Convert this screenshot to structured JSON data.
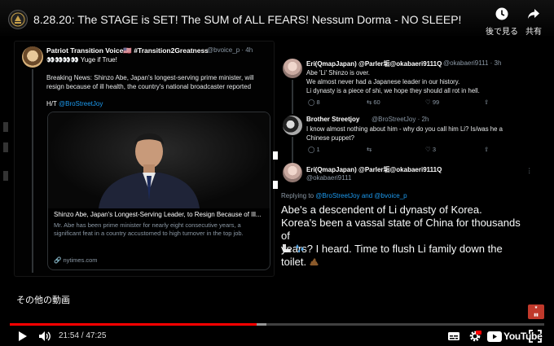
{
  "header": {
    "title": "8.28.20: The STAGE is SET! The SUM of ALL FEARS! Nessum Dorma - NO SLEEP!",
    "watch_later_label": "後で見る",
    "share_label": "共有"
  },
  "tweet1": {
    "name": "Patriot Transition Voice🇺🇸 #Transition2Greatness",
    "handle": "@bvoice_p · 4h",
    "line": "👀👀👀👀 Yuge if True!",
    "body": "Breaking News: Shinzo Abe, Japan's longest-serving prime minister, will resign because of ill health, the country's national broadcaster reported",
    "ht_prefix": "H/T",
    "ht_mention": "@BroStreetJoy",
    "card": {
      "title": "Shinzo Abe, Japan's Longest-Serving Leader, to Resign Because of Ill...",
      "description": "Mr. Abe has been prime minister for nearly eight consecutive years, a significant feat in a country accustomed to high turnover in the top job.",
      "domain": "nytimes.com"
    }
  },
  "tweet2": {
    "name": "Eri(QmapJapan) @Parler垢@okabaeri9111Q",
    "handle": "@okabaeri9111 · 3h",
    "lines": [
      "Abe 'Li' Shinzo is over.",
      "We almost never had a Japanese leader in our history.",
      "Li dynasty is a piece of shi, we hope they should all rot in hell."
    ],
    "replies": "8",
    "retweets": "60",
    "likes": "99"
  },
  "tweet3": {
    "name": "Brother Streetjoy",
    "handle": "@BroStreetJoy · 2h",
    "lines": [
      "I know almost nothing about him - why do you call him Li? Is/was he a",
      "Chinese puppet?"
    ],
    "replies": "1",
    "retweets": "",
    "likes": "3"
  },
  "tweet4": {
    "name": "Eri(QmapJapan) @Parler垢@okabaeri9111Q",
    "handle": "@okabaeri9111",
    "reply_prefix": "Replying to",
    "reply_mentions": "@BroStreetJoy and @bvoice_p",
    "lines": [
      "Abe's a descendent of Li dynasty of Korea.",
      "Korea's been a vassal state of China for thousands of",
      "years? I heard. Time to flush Li family down the toilet."
    ]
  },
  "overlay": {
    "more_videos": "その他の動画"
  },
  "player": {
    "current_time": "21:54",
    "separator": " / ",
    "duration": "47:25",
    "played_fraction": 0.462,
    "buffered_fraction": 0.48,
    "logo_text": "YouTube"
  },
  "colors": {
    "accent": "#ff0000",
    "mention": "#1d9bf0",
    "muted": "#8b98a5"
  }
}
